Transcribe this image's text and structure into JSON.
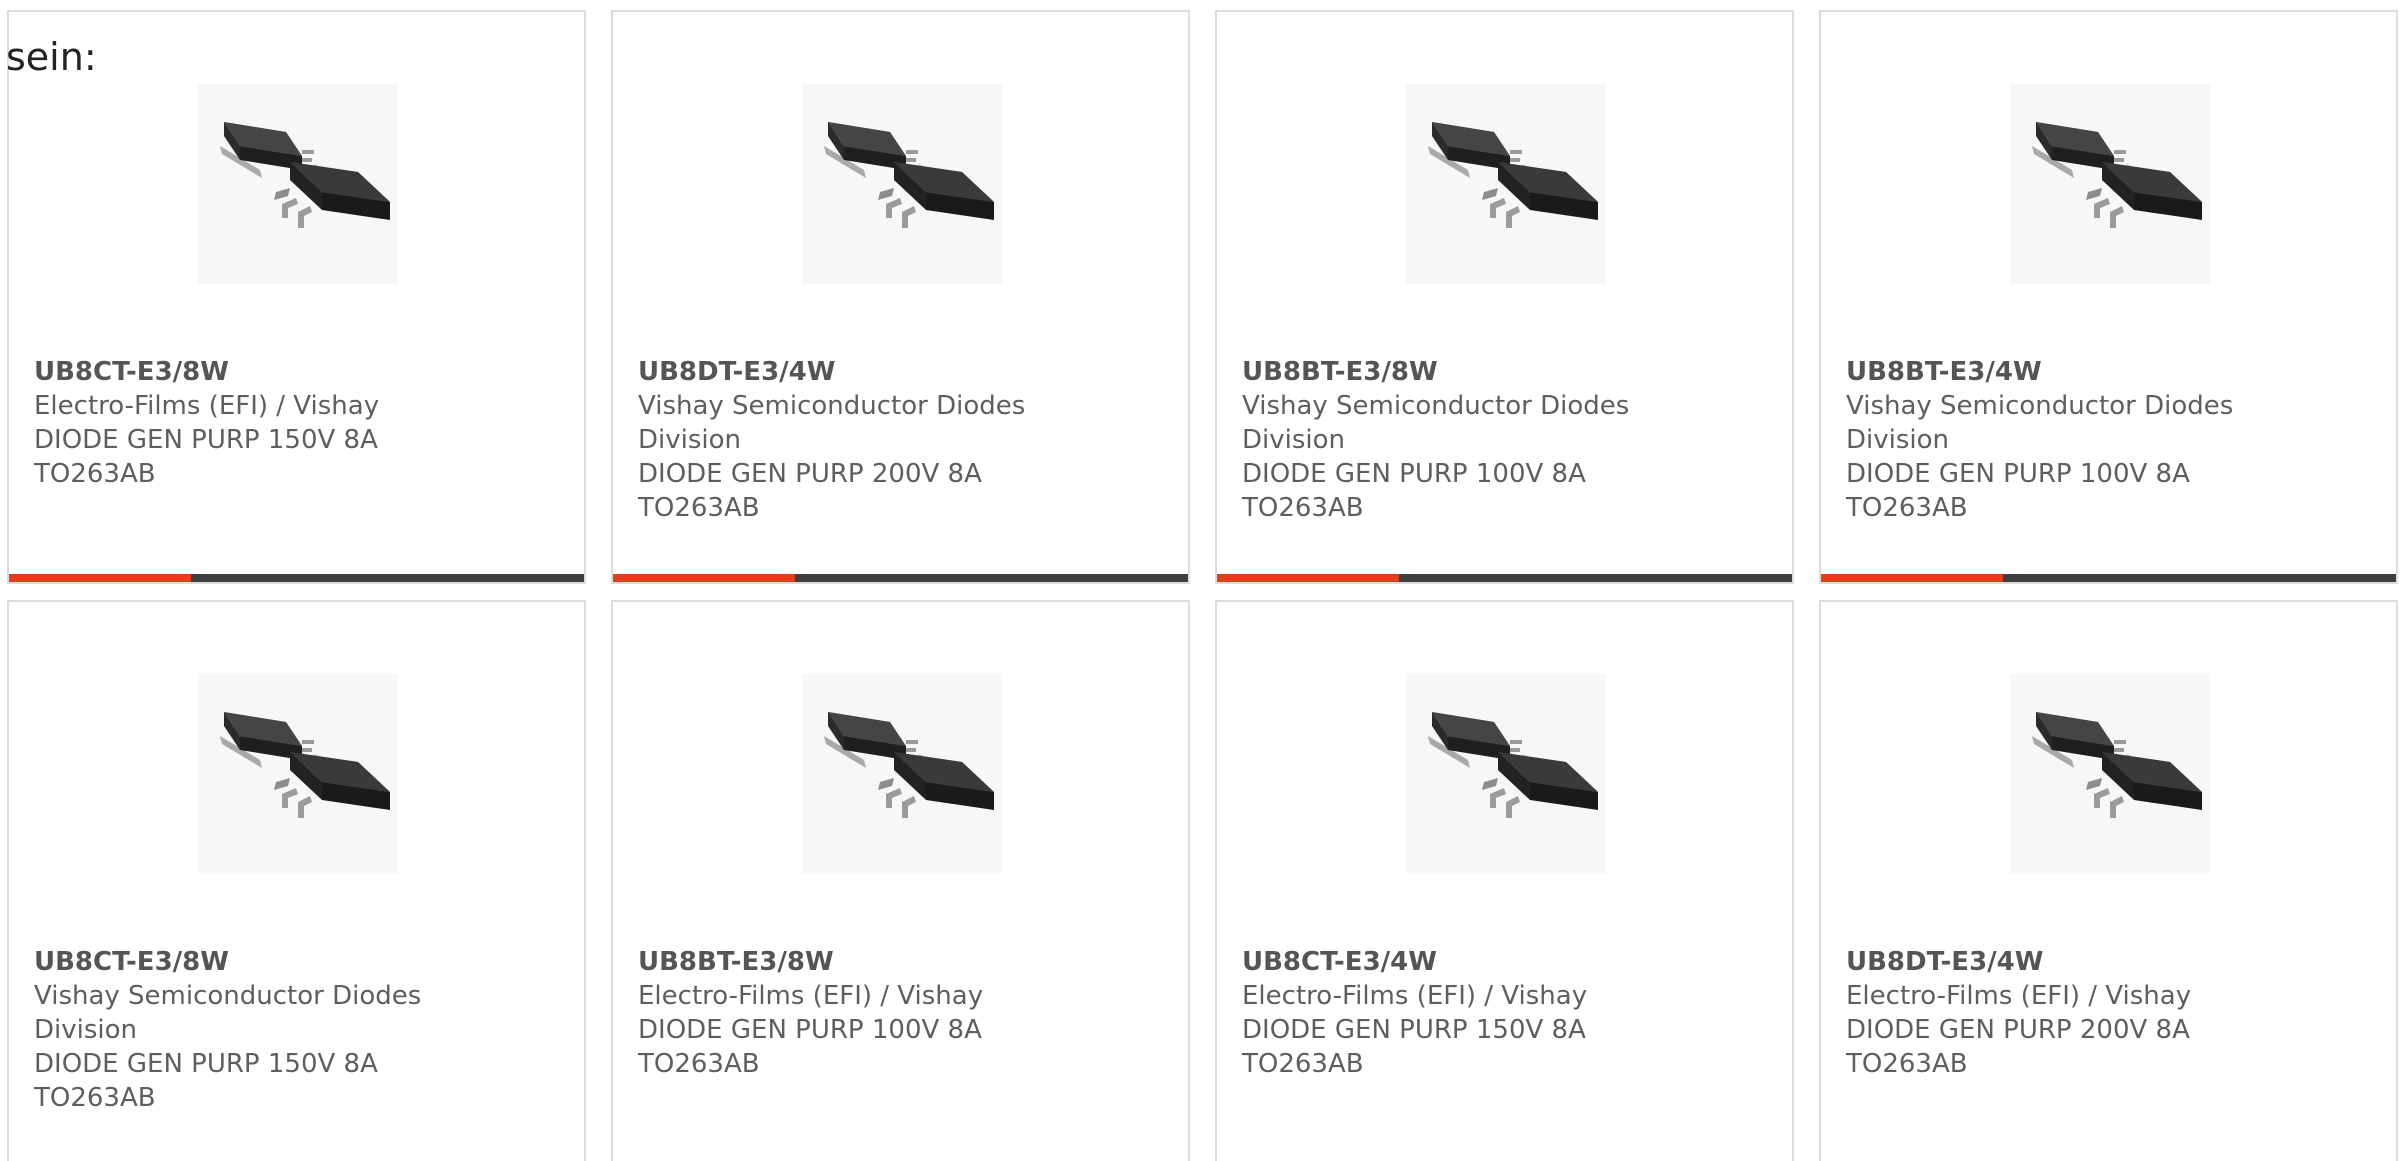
{
  "intro_text": "sein:",
  "colors": {
    "accent_orange": "#e0411c",
    "accent_dark": "#3f3f3f",
    "border": "#dcdcdc",
    "text": "#5e5e5e"
  },
  "products": [
    {
      "part_number": "UB8CT-E3/8W",
      "manufacturer": "Electro-Films (EFI) / Vishay",
      "description_1": "DIODE GEN PURP 150V 8A",
      "description_2": "TO263AB",
      "image_icon": "diode-package-image",
      "accent_bar": true
    },
    {
      "part_number": "UB8DT-E3/4W",
      "manufacturer": "Vishay Semiconductor Diodes Division",
      "description_1": "DIODE GEN PURP 200V 8A",
      "description_2": "TO263AB",
      "image_icon": "diode-package-image",
      "accent_bar": true
    },
    {
      "part_number": "UB8BT-E3/8W",
      "manufacturer": "Vishay Semiconductor Diodes Division",
      "description_1": "DIODE GEN PURP 100V 8A",
      "description_2": "TO263AB",
      "image_icon": "diode-package-image",
      "accent_bar": true
    },
    {
      "part_number": "UB8BT-E3/4W",
      "manufacturer": "Vishay Semiconductor Diodes Division",
      "description_1": "DIODE GEN PURP 100V 8A",
      "description_2": "TO263AB",
      "image_icon": "diode-package-image",
      "accent_bar": true
    },
    {
      "part_number": "UB8CT-E3/8W",
      "manufacturer": "Vishay Semiconductor Diodes Division",
      "description_1": "DIODE GEN PURP 150V 8A",
      "description_2": "TO263AB",
      "image_icon": "diode-package-image",
      "accent_bar": false
    },
    {
      "part_number": "UB8BT-E3/8W",
      "manufacturer": "Electro-Films (EFI) / Vishay",
      "description_1": "DIODE GEN PURP 100V 8A",
      "description_2": "TO263AB",
      "image_icon": "diode-package-image",
      "accent_bar": false
    },
    {
      "part_number": "UB8CT-E3/4W",
      "manufacturer": "Electro-Films (EFI) / Vishay",
      "description_1": "DIODE GEN PURP 150V 8A",
      "description_2": "TO263AB",
      "image_icon": "diode-package-image",
      "accent_bar": false
    },
    {
      "part_number": "UB8DT-E3/4W",
      "manufacturer": "Electro-Films (EFI) / Vishay",
      "description_1": "DIODE GEN PURP 200V 8A",
      "description_2": "TO263AB",
      "image_icon": "diode-package-image",
      "accent_bar": false
    }
  ]
}
